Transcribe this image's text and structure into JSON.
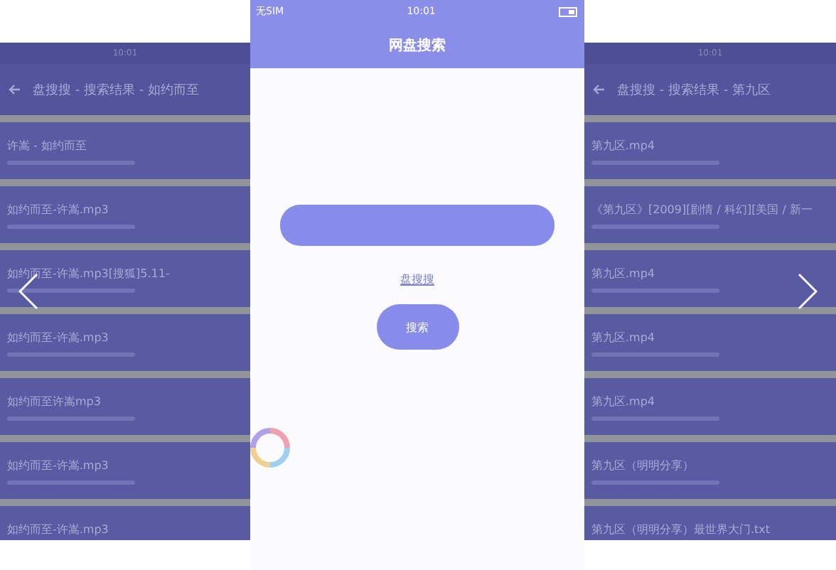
{
  "left_screen": {
    "status_bar": {
      "time": "10:01"
    },
    "header": {
      "title": "盘搜搜 - 搜索结果 - 如约而至"
    },
    "results": [
      {
        "title": "许嵩 - 如约而至"
      },
      {
        "title": "如约而至-许嵩.mp3"
      },
      {
        "title": "如约而至-许嵩.mp3[搜狐]5.11-"
      },
      {
        "title": "如约而至-许嵩.mp3"
      },
      {
        "title": "如约而至许嵩mp3"
      },
      {
        "title": "如约而至-许嵩.mp3"
      },
      {
        "title": "如约而至-许嵩.mp3"
      }
    ]
  },
  "center_screen": {
    "status_bar": {
      "carrier": "无SIM",
      "time": "10:01"
    },
    "header": {
      "title": "网盘搜索"
    },
    "link": "盘搜搜",
    "search_button": "搜索"
  },
  "right_screen": {
    "status_bar": {
      "time": "10:01"
    },
    "header": {
      "title": "盘搜搜 - 搜索结果 - 第九区"
    },
    "results": [
      {
        "title": "第九区.mp4"
      },
      {
        "title": "《第九区》[2009][剧情 / 科幻][美国 / 新一"
      },
      {
        "title": "第九区.mp4"
      },
      {
        "title": "第九区.mp4"
      },
      {
        "title": "第九区.mp4"
      },
      {
        "title": "第九区（明明分享）"
      },
      {
        "title": "第九区（明明分享）最世界大门.txt"
      }
    ]
  }
}
